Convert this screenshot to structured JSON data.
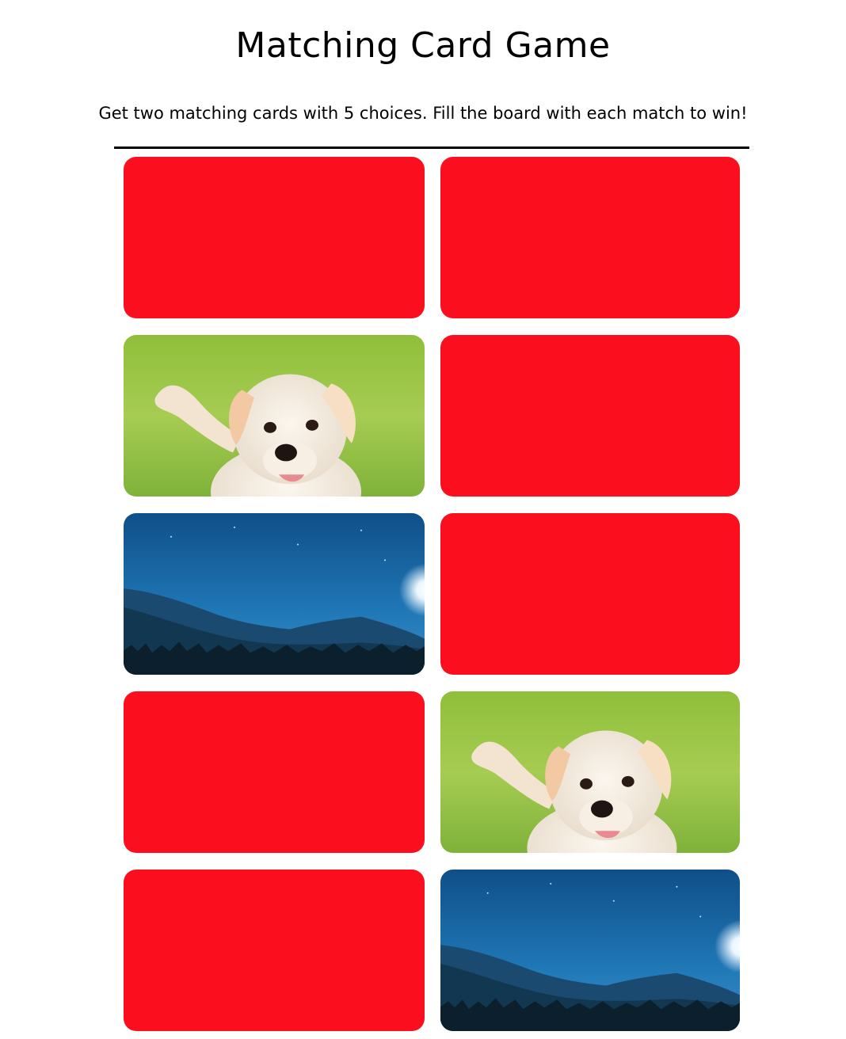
{
  "header": {
    "title": "Matching Card Game",
    "subtitle": "Get two matching cards with 5 choices. Fill the board with each match to win!"
  },
  "colors": {
    "card_back": "#fb0e1e",
    "divider": "#000000",
    "background": "#ffffff"
  },
  "board": {
    "cards": [
      {
        "state": "face-down",
        "image": ""
      },
      {
        "state": "face-down",
        "image": ""
      },
      {
        "state": "face-up",
        "image": "puppy"
      },
      {
        "state": "face-down",
        "image": ""
      },
      {
        "state": "face-up",
        "image": "night-mountain"
      },
      {
        "state": "face-down",
        "image": ""
      },
      {
        "state": "face-down",
        "image": ""
      },
      {
        "state": "face-up",
        "image": "puppy"
      },
      {
        "state": "face-down",
        "image": ""
      },
      {
        "state": "face-up",
        "image": "night-mountain"
      }
    ]
  }
}
